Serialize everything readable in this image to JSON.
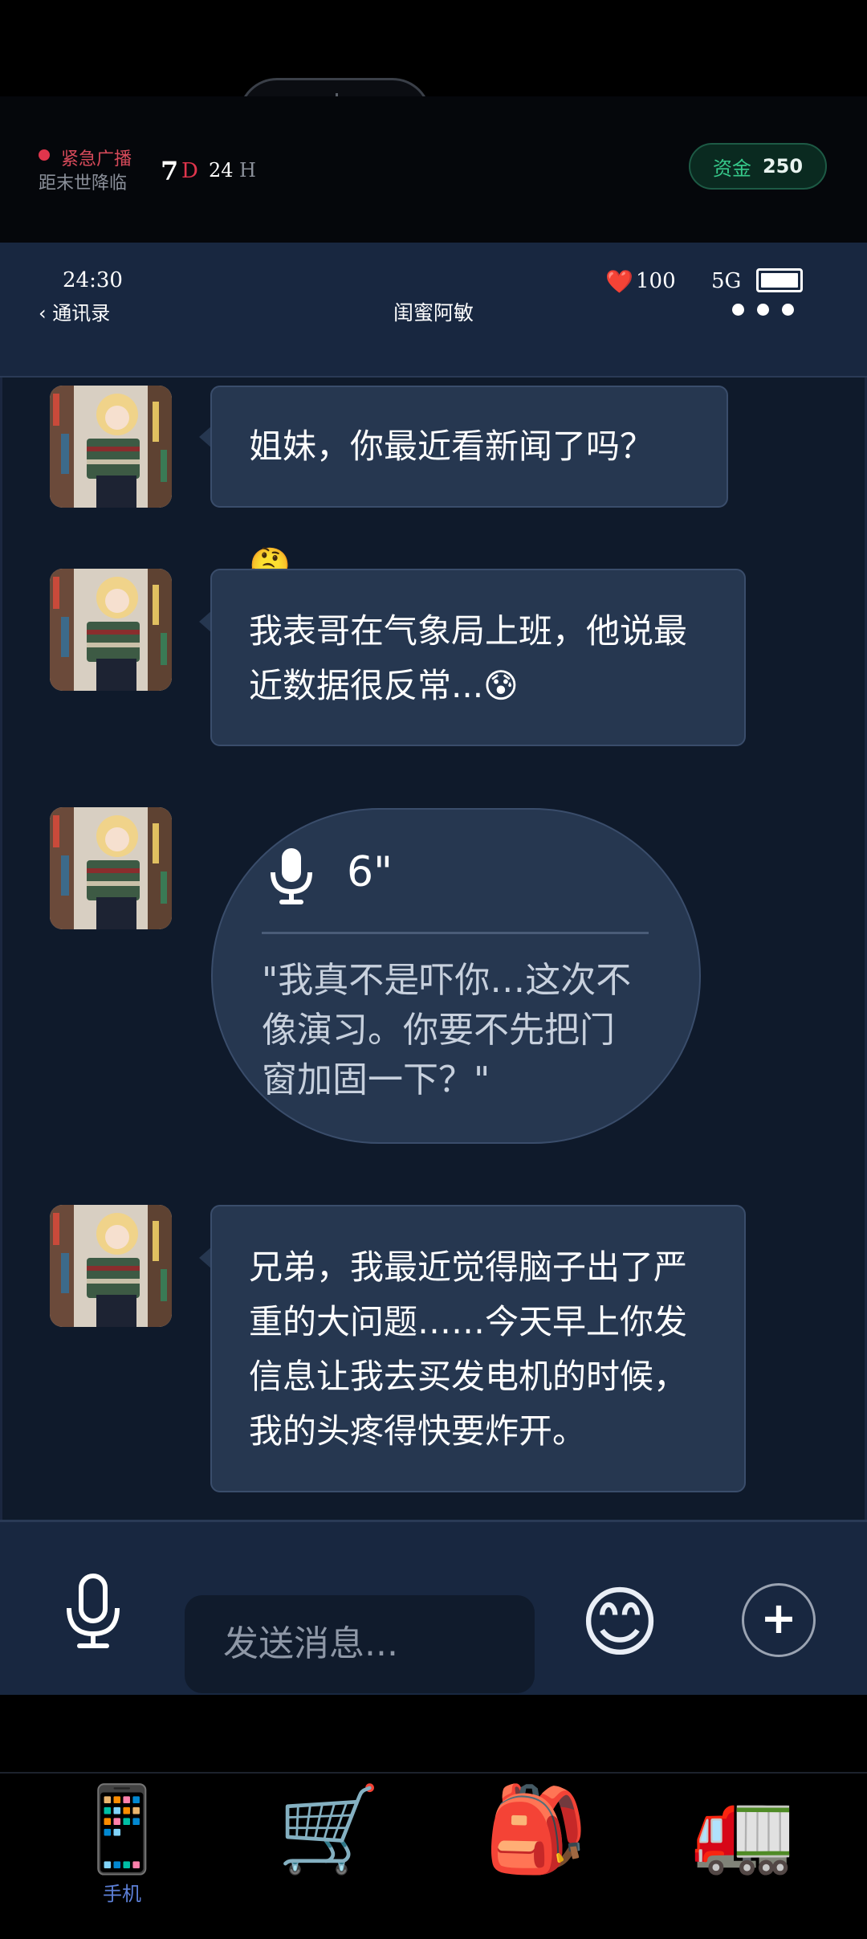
{
  "capsule": {
    "more_icon": "more-dots-icon",
    "close_icon": "target-close-icon"
  },
  "game_header": {
    "emergency_label": "紧急广播",
    "countdown_label": "距末世降临",
    "days_value": "7",
    "days_unit": "D",
    "hours_value": "24",
    "hours_unit": "H",
    "funds_label": "资金",
    "funds_value": "250"
  },
  "status_bar": {
    "time": "24:30",
    "health_icon": "❤️",
    "health": "100",
    "network": "5G",
    "battery_level": 1.0
  },
  "chat_header": {
    "back_label": "通讯录",
    "contact_name": "闺蜜阿敏"
  },
  "messages": [
    {
      "type": "text",
      "text": "姐妹，你最近看新闻了吗？🤔"
    },
    {
      "type": "text",
      "lines": [
        "我表哥在气象局上班，他说最",
        "近数据很反常...😰"
      ]
    },
    {
      "type": "voice",
      "duration": "6\"",
      "transcript_lines": [
        "\"我真不是吓你…这次不",
        "像演习。你要不先把门",
        "窗加固一下？\""
      ]
    },
    {
      "type": "text",
      "lines": [
        "兄弟，我最近觉得脑子出了严",
        "重的大问题……今天早上你发",
        "信息让我去买发电机的时候，",
        "我的头疼得快要炸开。"
      ]
    }
  ],
  "input_bar": {
    "placeholder": "发送消息...",
    "emoji": "😊",
    "plus": "+"
  },
  "bottom_nav": [
    {
      "icon": "📱",
      "label": "手机",
      "active": true
    },
    {
      "icon": "🛒",
      "label": ""
    },
    {
      "icon": "🎒",
      "label": ""
    },
    {
      "icon": "🚛",
      "label": ""
    }
  ],
  "colors": {
    "accent_red": "#e0354c",
    "funds_green": "#36c98a",
    "bubble": "#263750",
    "nav_active": "#5c7fd6"
  }
}
